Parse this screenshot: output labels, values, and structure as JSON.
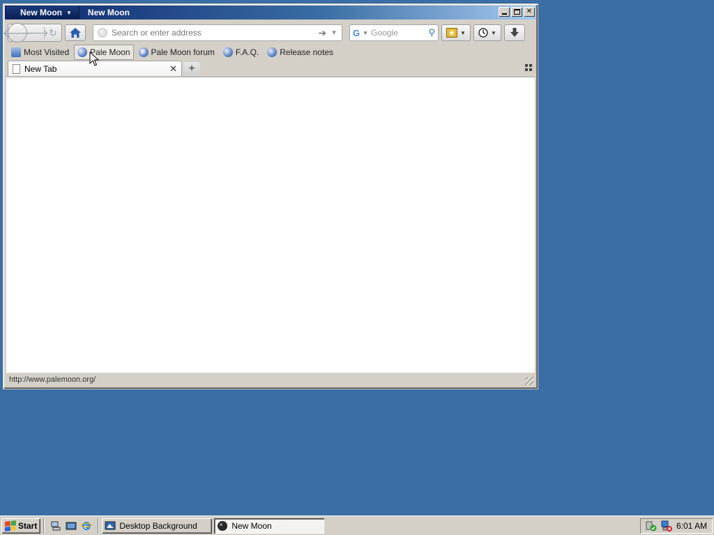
{
  "window": {
    "app_menu_label": "New Moon",
    "title": "New Moon"
  },
  "navbar": {
    "url_placeholder": "Search or enter address",
    "search_placeholder": "Google",
    "search_engine_letter": "G"
  },
  "bookmarks": [
    {
      "label": "Most Visited",
      "icon": "search-folder-icon"
    },
    {
      "label": "Pale Moon",
      "icon": "globe-icon"
    },
    {
      "label": "Pale Moon forum",
      "icon": "forum-icon"
    },
    {
      "label": "F.A.Q.",
      "icon": "globe-icon"
    },
    {
      "label": "Release notes",
      "icon": "globe-icon"
    }
  ],
  "tabs": [
    {
      "label": "New Tab"
    }
  ],
  "statusbar": {
    "text": "http://www.palemoon.org/"
  },
  "taskbar": {
    "start_label": "Start",
    "tasks": [
      {
        "label": "Desktop Background",
        "active": false
      },
      {
        "label": "New Moon",
        "active": true
      }
    ],
    "clock": "6:01 AM"
  },
  "colors": {
    "desktop": "#3a6ea5",
    "titlebar_start": "#0a246a",
    "chrome": "#d4d0c8"
  }
}
